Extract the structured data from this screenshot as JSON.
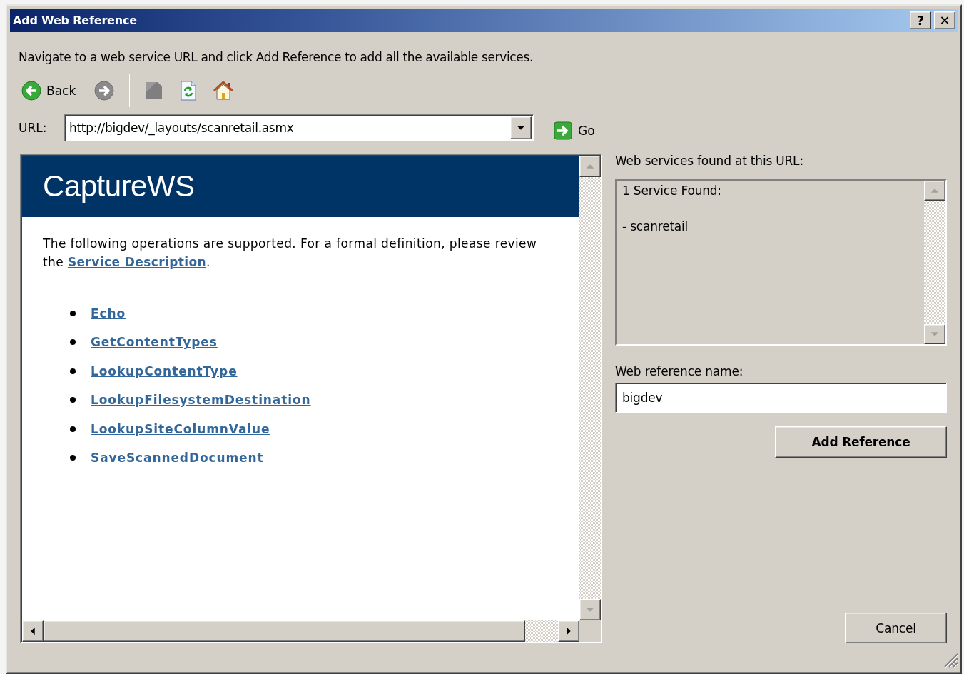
{
  "window": {
    "title": "Add Web Reference",
    "title_buttons": [
      "?",
      "✕"
    ]
  },
  "instruction": "Navigate to a web service URL and click Add Reference to add all the available services.",
  "toolbar": [
    {
      "kind": "back",
      "label": "Back",
      "disabled": false
    },
    {
      "kind": "forward",
      "disabled": true
    },
    {
      "kind": "stop",
      "disabled": true
    },
    {
      "kind": "refresh",
      "disabled": false
    },
    {
      "kind": "home",
      "disabled": false
    }
  ],
  "url": {
    "label": "URL:",
    "value": "http://bigdev/_layouts/scanretail.asmx"
  },
  "go": {
    "label": "Go"
  },
  "browser": {
    "heading": "CaptureWS",
    "intro_before": "The following operations are supported. For a formal definition, please review the ",
    "intro_link": "Service Description",
    "intro_after": ".",
    "operations": [
      "Echo",
      "GetContentTypes",
      "LookupContentType",
      "LookupFilesystemDestination",
      "LookupSiteColumnValue",
      "SaveScannedDocument"
    ]
  },
  "services": {
    "label": "Web services found at this URL:",
    "lines": [
      "1 Service Found:",
      "- scanretail"
    ]
  },
  "reference_name": {
    "label": "Web reference name:",
    "value": "bigdev"
  },
  "buttons": [
    {
      "kind": "primary",
      "label": "Add Reference"
    },
    {
      "kind": "cancel",
      "label": "Cancel"
    }
  ]
}
